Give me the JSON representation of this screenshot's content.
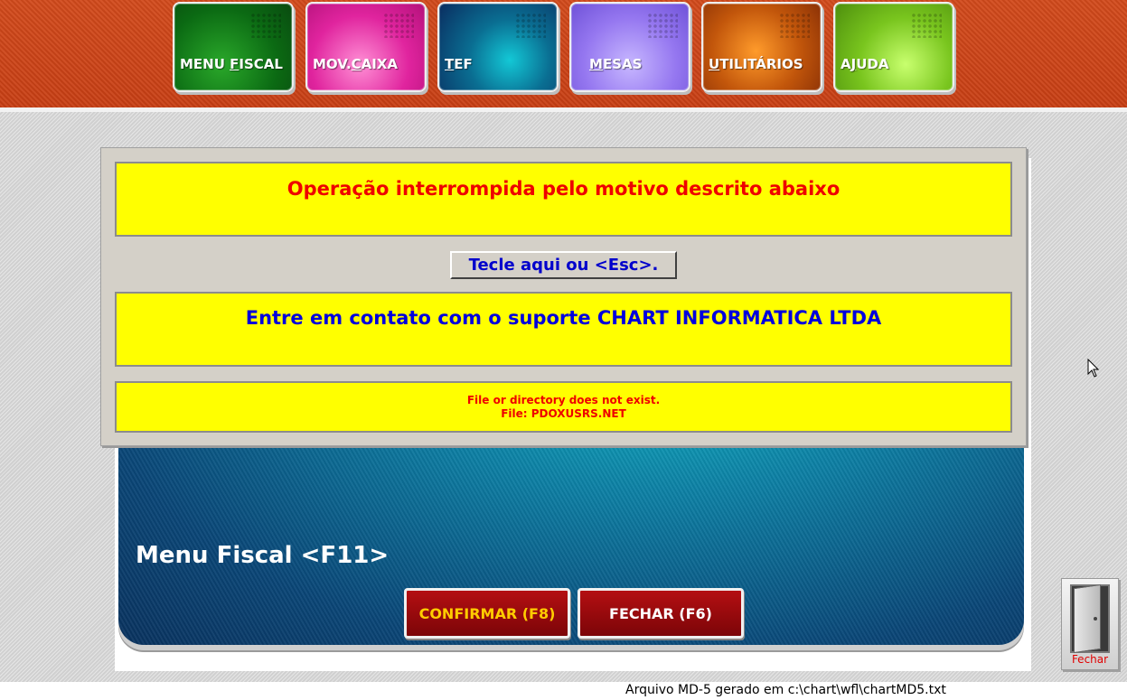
{
  "top_menu": [
    {
      "pre": "MENU ",
      "key": "F",
      "post": "ISCAL"
    },
    {
      "pre": "MOV.",
      "key": "C",
      "post": "AIXA"
    },
    {
      "pre": "",
      "key": "T",
      "post": "EF"
    },
    {
      "pre": "",
      "key": "M",
      "post": "ESAS"
    },
    {
      "pre": "",
      "key": "U",
      "post": "TILITÁRIOS"
    },
    {
      "pre": "A",
      "key": "J",
      "post": "UDA"
    }
  ],
  "dialog": {
    "title": "Operação interrompida pelo motivo descrito abaixo",
    "esc_button": "Tecle aqui ou <Esc>.",
    "support_message": "Entre em contato com o suporte CHART INFORMATICA LTDA",
    "error_line1": "File or directory does not exist.",
    "error_line2": "File: PDOXUSRS.NET"
  },
  "panel": {
    "title": "Menu Fiscal <F11>",
    "confirm_button": "CONFIRMAR (F8)",
    "close_button": "FECHAR (F6)"
  },
  "door_button": {
    "label": "Fechar",
    "icon": "door-icon"
  },
  "footer": {
    "text": "Arquivo MD-5 gerado em c:\\chart\\wfl\\chartMD5.txt"
  },
  "colors": {
    "top_band": "#c83f14",
    "dialog_yellow": "#ffff00",
    "error_red": "#ee0000",
    "support_blue": "#0000dd",
    "confirm_text": "#ffcc00"
  }
}
